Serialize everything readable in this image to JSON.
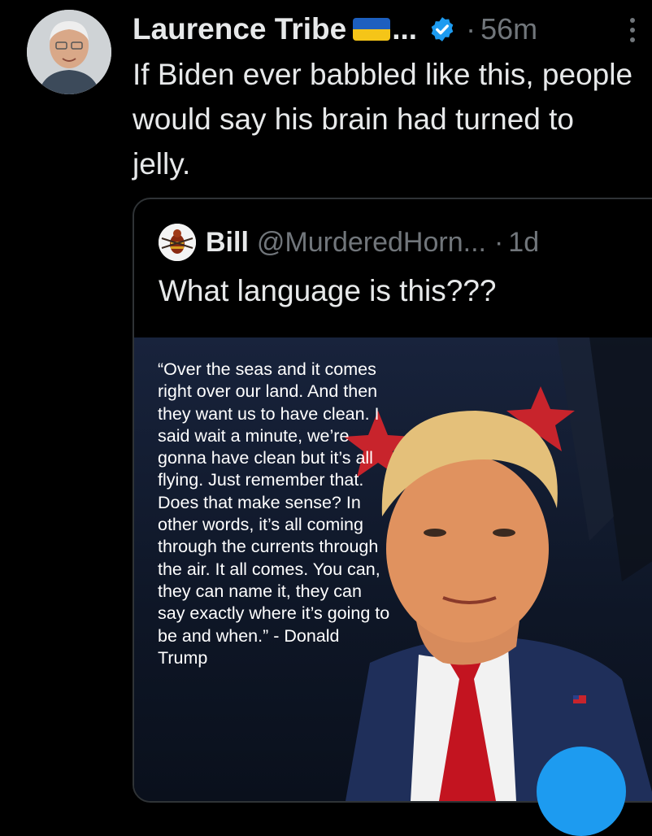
{
  "tweet": {
    "author_name": "Laurence Tribe",
    "name_ellipsis": "...",
    "separator": "·",
    "time": "56m",
    "text": "If Biden ever babbled like this, people would say his brain had turned to jelly."
  },
  "quoted": {
    "author_name": "Bill",
    "handle": "@MurderedHorn...",
    "separator": "·",
    "time": "1d",
    "text": "What language is this???",
    "image_quote": "“Over the seas and it comes right over our land. And then they want us to have clean. I said wait a minute, we’re gonna have clean but it’s all flying. Just remember that. Does that make sense? In other words, it’s all coming through the currents through the air. It all comes. You can, they can name it, they can say exactly where it’s going to be and when.” - Donald Trump"
  },
  "colors": {
    "background": "#000000",
    "text": "#e7e9ea",
    "muted": "#71767b",
    "accent": "#1d9bf0"
  },
  "icons": [
    "verified-badge-icon",
    "more-options-icon",
    "ukraine-flag-icon"
  ]
}
